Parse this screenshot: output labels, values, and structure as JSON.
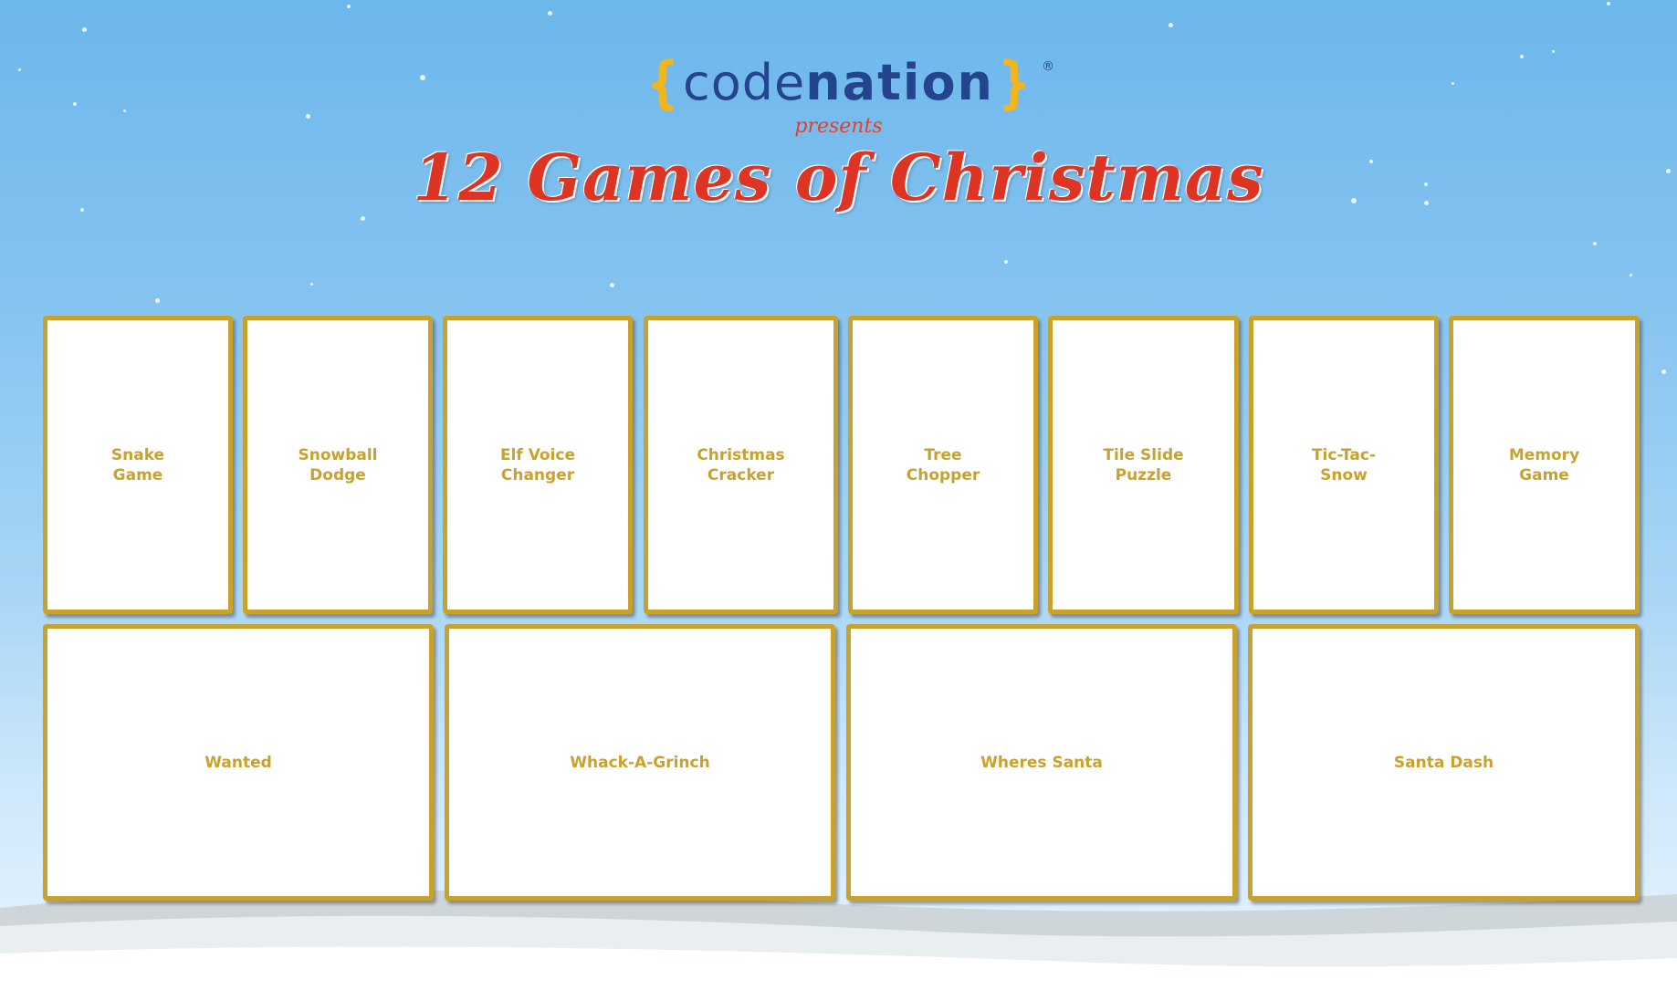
{
  "header": {
    "logo": {
      "brace_open": "{",
      "code": "code",
      "nation": "nation",
      "brace_close": "}",
      "registered": "®"
    },
    "presents": "presents",
    "title": "12 Games of Christmas"
  },
  "games_row_1": [
    {
      "label": "Snake\nGame"
    },
    {
      "label": "Snowball\nDodge"
    },
    {
      "label": "Elf Voice\nChanger"
    },
    {
      "label": "Christmas\nCracker"
    },
    {
      "label": "Tree\nChopper"
    },
    {
      "label": "Tile Slide\nPuzzle"
    },
    {
      "label": "Tic-Tac-\nSnow"
    },
    {
      "label": "Memory\nGame"
    }
  ],
  "games_row_2": [
    {
      "label": "Wanted"
    },
    {
      "label": "Whack-A-Grinch"
    },
    {
      "label": "Wheres Santa"
    },
    {
      "label": "Santa Dash"
    }
  ],
  "colors": {
    "card_border": "#c9a22d",
    "card_text": "#c9a22d",
    "title_red": "#dd3424",
    "logo_blue": "#24448e",
    "logo_brace": "#f2b51d",
    "sky_top": "#6cb7ec"
  }
}
